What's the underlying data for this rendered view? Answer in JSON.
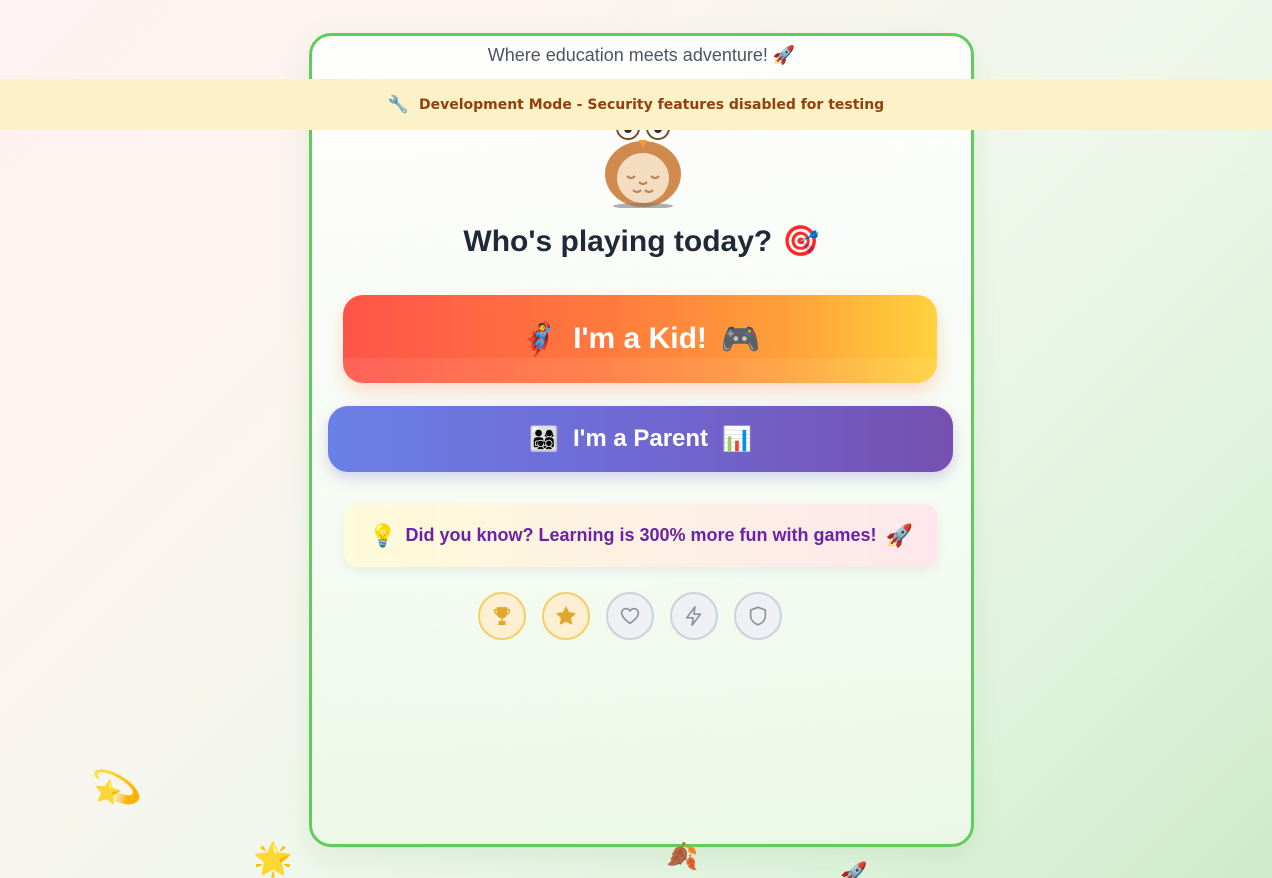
{
  "tagline": "Where education meets adventure! 🚀",
  "dev_banner": {
    "icon": "🔧",
    "text": "Development Mode - Security features disabled for testing"
  },
  "heading": {
    "text": "Who's playing today?",
    "emoji": "🎯"
  },
  "kid_button": {
    "left_icon": "🦸",
    "label": "I'm a Kid!",
    "right_icon": "🎮"
  },
  "parent_button": {
    "left_icon": "👨‍👩‍👧‍👦",
    "label": "I'm a Parent",
    "right_icon": "📊"
  },
  "fun_fact": {
    "left_icon": "💡",
    "text": "Did you know? Learning is 300% more fun with games!",
    "right_icon": "🚀"
  },
  "badges": [
    {
      "icon": "trophy-icon",
      "state": "earned"
    },
    {
      "icon": "star-icon",
      "state": "earned"
    },
    {
      "icon": "heart-icon",
      "state": "locked"
    },
    {
      "icon": "zap-icon",
      "state": "locked"
    },
    {
      "icon": "shield-icon",
      "state": "locked"
    }
  ],
  "decorations": {
    "sparkle": "💫",
    "glowing_star": "🌟",
    "leaf": "🍂",
    "rocket": "🚀"
  },
  "colors": {
    "card_border": "#5fcd5c",
    "kid_gradient_start": "#ff5449",
    "kid_gradient_end": "#ffd23c",
    "parent_gradient_start": "#6a80e6",
    "parent_gradient_end": "#7550b0",
    "fact_text": "#6b21a8",
    "badge_earned": "#e0a82e",
    "badge_locked": "#9ca3af",
    "dev_banner_bg": "#fdf2c7",
    "dev_banner_text": "#92400e"
  }
}
